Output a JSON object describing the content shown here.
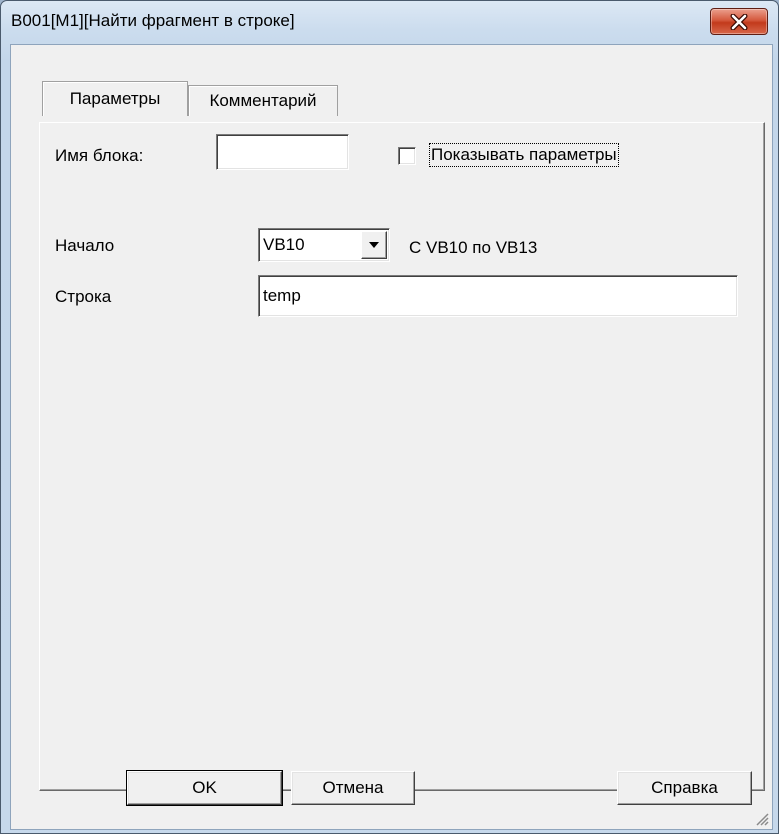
{
  "window": {
    "title": "B001[M1][Найти фрагмент в строке]",
    "close_icon": "close-icon"
  },
  "tabs": [
    {
      "label": "Параметры",
      "active": true
    },
    {
      "label": "Комментарий",
      "active": false
    }
  ],
  "form": {
    "block_name_label": "Имя блока:",
    "block_name_value": "",
    "show_params_label": "Показывать параметры",
    "show_params_checked": false,
    "start_label": "Начало",
    "start_value": "VB10",
    "start_range": "С VB10 по VB13",
    "string_label": "Строка",
    "string_value": "temp"
  },
  "buttons": {
    "ok": "OK",
    "cancel": "Отмена",
    "help": "Справка"
  }
}
